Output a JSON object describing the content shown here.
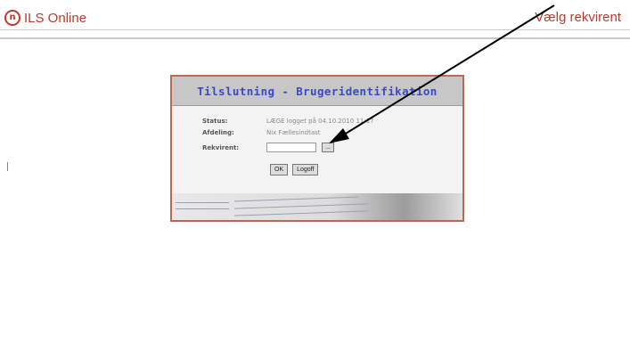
{
  "app": {
    "logo_glyph": "n",
    "title": "ILS Online"
  },
  "page": {
    "heading": "Vælg rekvirent"
  },
  "dialog": {
    "title": "Tilslutning - Brugeridentifikation",
    "status_label": "Status:",
    "status_value": "LÆGE logget på 04.10.2010 11:17",
    "department_label": "Afdeling:",
    "department_value": "Nix Fællesindtast",
    "requester_label": "Rekvirent:",
    "requester_value": "",
    "lookup_button": "...",
    "ok_button": "OK",
    "logoff_button": "Logoff"
  },
  "colors": {
    "accent": "#c0392b",
    "title_blue": "#3b49c9",
    "dialog_border": "#b86a56",
    "arrow": "#000000"
  }
}
